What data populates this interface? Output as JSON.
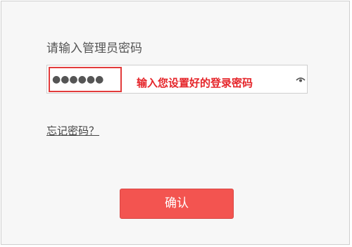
{
  "login": {
    "prompt": "请输入管理员密码",
    "password_value": "●●●●●●",
    "annotation": "输入您设置好的登录密码",
    "show_password_icon": "eye-icon",
    "forgot_link": "忘记密码？",
    "confirm_label": "确认"
  },
  "colors": {
    "accent": "#f35450",
    "annotation": "#e5252a"
  }
}
